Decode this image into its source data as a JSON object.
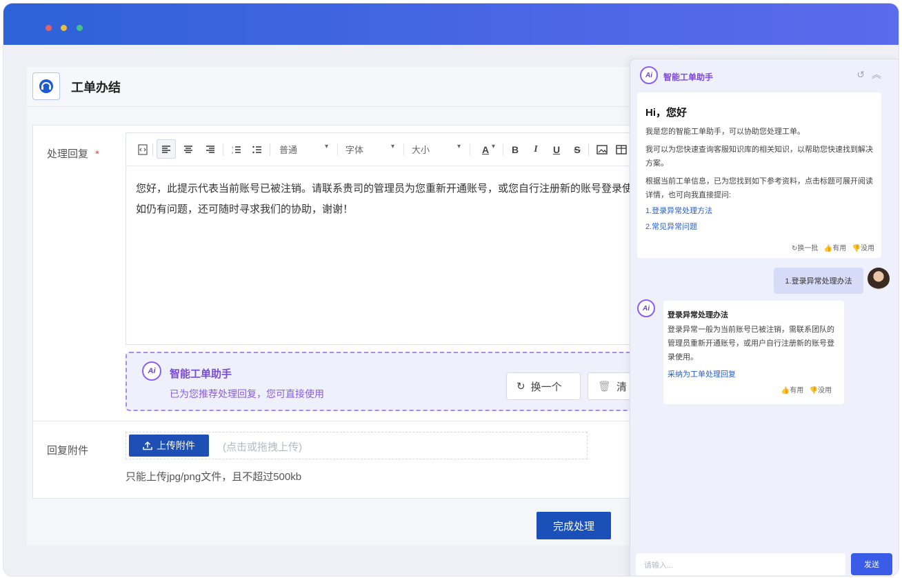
{
  "page": {
    "title": "工单办结"
  },
  "form": {
    "reply_label": "处理回复",
    "required_mark": "*",
    "toolbar": {
      "paragraph_select": "普通",
      "font_select": "字体",
      "size_select": "大小",
      "bold": "B",
      "italic": "I",
      "underline": "U",
      "strike": "S",
      "font_color": "A"
    },
    "reply_text": "您好，此提示代表当前账号已被注销。请联系贵司的管理员为您重新开通账号，或您自行注册新的账号登录使用，如仍有问题，还可随时寻求我们的协助，谢谢！",
    "ai_suggest": {
      "title": "智能工单助手",
      "subtitle": "已为您推荐处理回复，您可直接使用",
      "change_label": "换一个",
      "clear_label": "清"
    },
    "attachment_label": "回复附件",
    "upload_button": "上传附件",
    "upload_hint": "(点击或拖拽上传)",
    "upload_note": "只能上传jpg/png文件，且不超过500kb",
    "finish_button": "完成处理"
  },
  "assistant": {
    "title": "智能工单助手",
    "logo_text": "Ai",
    "greeting": {
      "heading": "Hi，您好",
      "line1": "我是您的智能工单助手，可以协助您处理工单。",
      "line2": "我可以为您快速查询客服知识库的相关知识，以帮助您快速找到解决方案。",
      "line3": "根据当前工单信息，已为您找到如下参考资料，点击标题可展开阅读详情，也可向我直接提问:",
      "links": [
        "1.登录异常处理方法",
        "2.常见异常问题"
      ],
      "refresh": "换一批",
      "useful": "有用",
      "useless": "没用"
    },
    "user_message": "1.登录异常处理办法",
    "answer": {
      "title": "登录异常处理办法",
      "body": "登录异常一般为当前账号已被注销，需联系团队的管理员重新开通账号，或用户自行注册新的账号登录使用。",
      "adopt_link": "采纳为工单处理回复",
      "useful": "有用",
      "useless": "没用"
    },
    "input_placeholder": "请输入...",
    "send_label": "发送"
  },
  "colors": {
    "titlebar": "#3f64e2",
    "primary": "#1a50b8",
    "ai_purple": "#7a4ad8",
    "link": "#2a5ec9"
  }
}
